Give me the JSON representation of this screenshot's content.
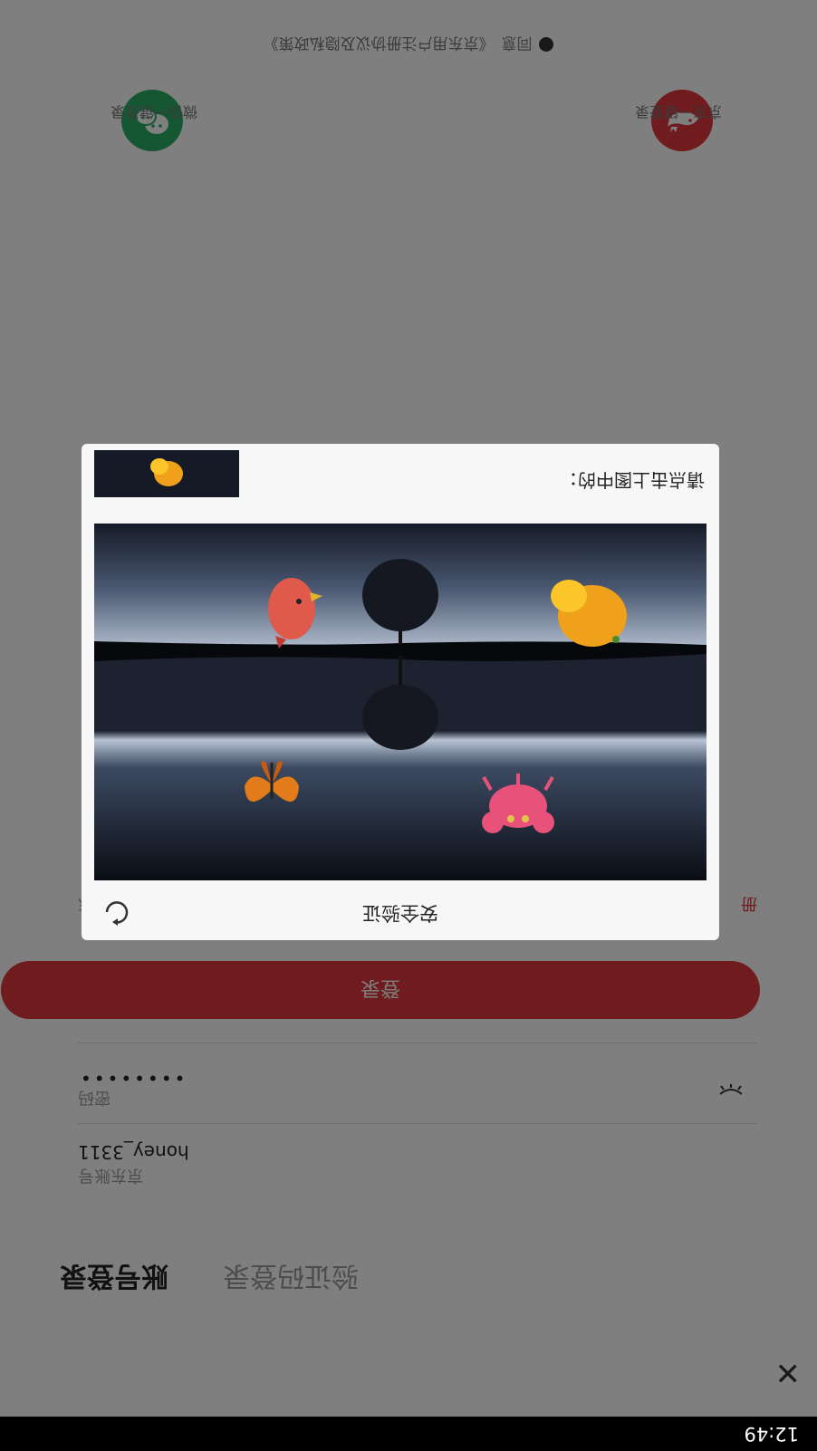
{
  "status": {
    "time": "12:49"
  },
  "tabs": {
    "account": "账号登录",
    "sms": "验证码登录"
  },
  "account_field": {
    "label": "京东账号",
    "value": "honey_3311"
  },
  "password_field": {
    "label": "密码",
    "value": "••••••••"
  },
  "login_label": "登录",
  "links": {
    "forgot": "忘",
    "register": "册"
  },
  "social": {
    "wechat": "微信一键登录",
    "jd": "京东一键登录"
  },
  "agreement": {
    "agree": "同意",
    "terms": "《京东用户注册协议及隐私政策》"
  },
  "captcha": {
    "title": "安全验证",
    "prompt": "请点击上图中的：",
    "objects": [
      "butterfly",
      "crab",
      "bird",
      "orange"
    ]
  },
  "colors": {
    "brand": "#e1363a",
    "wechat": "#2aae67",
    "overlay": "rgba(0,0,0,0.5)"
  },
  "icons": [
    "close-icon",
    "eye-icon",
    "refresh-icon",
    "wechat-icon",
    "jd-icon",
    "checkbox-icon"
  ]
}
